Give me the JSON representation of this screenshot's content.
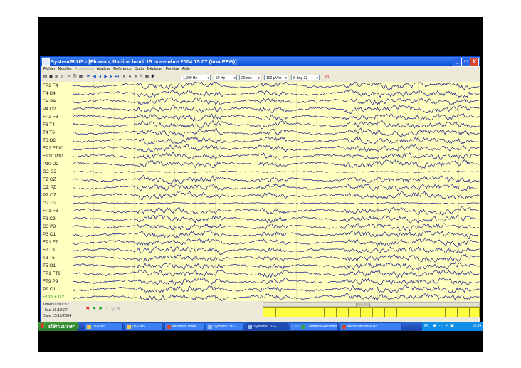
{
  "window": {
    "title": "SystemPLUS - [Floreao, Nadine lundi 15 novembre 2004 15:07 (Vou EEG)]",
    "controls": [
      "_",
      "□",
      "X"
    ]
  },
  "menu": [
    {
      "label": "Fichier",
      "enabled": true
    },
    {
      "label": "Modifier",
      "enabled": true
    },
    {
      "label": "Acquisition",
      "enabled": false
    },
    {
      "label": "Analyse",
      "enabled": true
    },
    {
      "label": "Reference",
      "enabled": true
    },
    {
      "label": "Outils",
      "enabled": true
    },
    {
      "label": "Déplacer",
      "enabled": true
    },
    {
      "label": "Fenetre",
      "enabled": true
    },
    {
      "label": "Aide",
      "enabled": true
    }
  ],
  "toolbar": {
    "filter_hi": "1,000 Hz",
    "filter_lo": "50 Hz",
    "timebase": "20 sec",
    "gain": "100 µV/cr",
    "montage": "S-bng.23"
  },
  "channels": [
    "FP2 F4",
    "F4 C4",
    "C4 P4",
    "P4 O2",
    "FP2 F8",
    "F8 T4",
    "T4 T6",
    "T6 O2",
    "FP2 FT10",
    "FT10 P10",
    "P10 O2",
    "G2 G2",
    "FZ CZ",
    "CZ PZ",
    "PZ OZ",
    "G2 G2",
    "FP1 F3",
    "F3 C3",
    "C3 P3",
    "P3 O1",
    "FP1 F7",
    "F7 T3",
    "T3 T5",
    "T5 O1",
    "FP1 FT9",
    "FT9 P9",
    "P9 O1",
    "ECG + G2"
  ],
  "status": {
    "timer": "Timer  00:01:32",
    "hour": "Hour   15:13:27",
    "date": "Date   15/11/2004"
  },
  "taskbar": {
    "start_label": "démarrer",
    "tasks": [
      "08/2005",
      "08/2005",
      "Microsoft Powe...",
      "SystemPLUS",
      "SystemPLUS - [...",
      "Camtasia Recorder",
      "Microsoft Office Po..."
    ],
    "tasks_prefix": "Com",
    "lang": "FR",
    "clock": "15:34"
  },
  "colors": {
    "trace": "#1a1a8c",
    "eeg_bg": "#ffffc0",
    "titlebar": "#0a4fd6",
    "taskbar": "#2458c8",
    "start": "#3c9a3c"
  }
}
